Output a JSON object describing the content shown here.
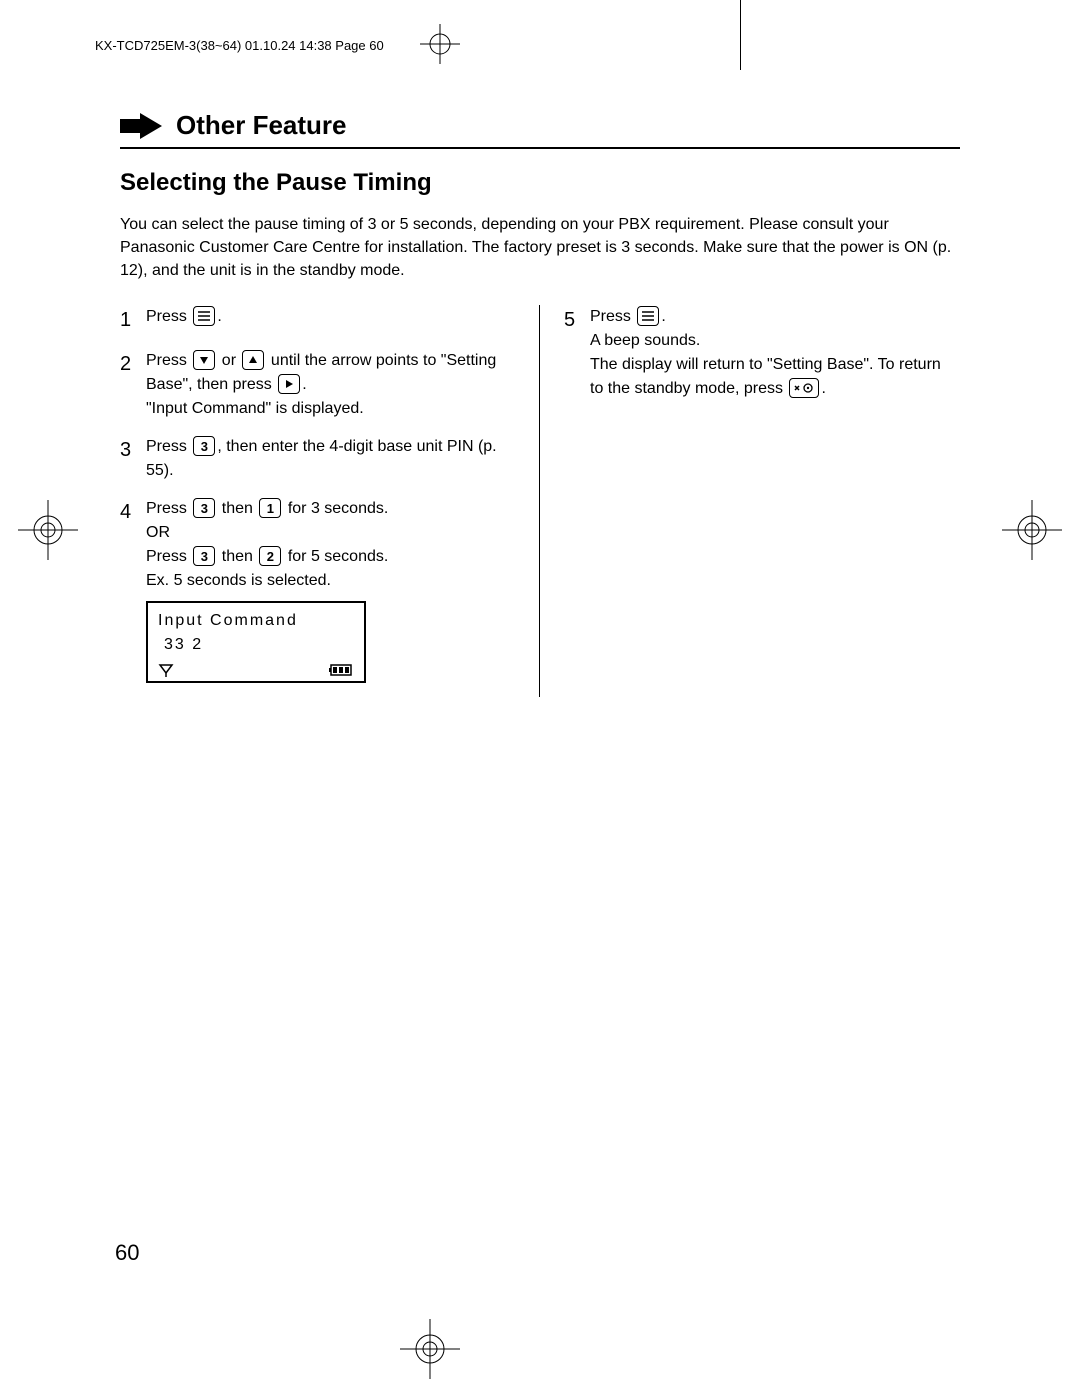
{
  "header": "KX-TCD725EM-3(38~64)  01.10.24 14:38  Page 60",
  "section_title": "Other Feature",
  "subtitle": "Selecting the Pause Timing",
  "intro": "You can select the pause timing of 3 or 5 seconds, depending on your PBX requirement. Please consult your Panasonic Customer Care Centre for installation. The factory preset is 3 seconds. Make sure that the power is ON (p. 12), and the unit is in the standby mode.",
  "steps_left": [
    {
      "num": "1",
      "parts": [
        "Press ",
        {
          "icon": "menu"
        },
        "."
      ]
    },
    {
      "num": "2",
      "parts": [
        "Press ",
        {
          "icon": "down"
        },
        " or ",
        {
          "icon": "up"
        },
        " until the arrow points to \"Setting Base\", then press ",
        {
          "icon": "right"
        },
        ".",
        {
          "break": true
        },
        "\"Input Command\" is displayed."
      ]
    },
    {
      "num": "3",
      "parts": [
        "Press ",
        {
          "icon": "3"
        },
        ", then enter the 4-digit base unit PIN (p. 55)."
      ]
    },
    {
      "num": "4",
      "parts": [
        "Press ",
        {
          "icon": "3"
        },
        " then ",
        {
          "icon": "1"
        },
        " for 3 seconds.",
        {
          "break": true
        },
        "OR",
        {
          "break": true
        },
        "Press ",
        {
          "icon": "3"
        },
        " then ",
        {
          "icon": "2"
        },
        " for 5 seconds.",
        {
          "break": true
        },
        "Ex. 5 seconds is selected."
      ],
      "lcd": {
        "line1": "Input Command",
        "line2": "33  2"
      }
    }
  ],
  "steps_right": [
    {
      "num": "5",
      "parts": [
        "Press ",
        {
          "icon": "menu"
        },
        ".",
        {
          "break": true
        },
        "A beep sounds.",
        {
          "break": true
        },
        "The display will return to \"Setting Base\". To return to the standby mode, press ",
        {
          "icon": "power"
        },
        "."
      ]
    }
  ],
  "page_number": "60"
}
